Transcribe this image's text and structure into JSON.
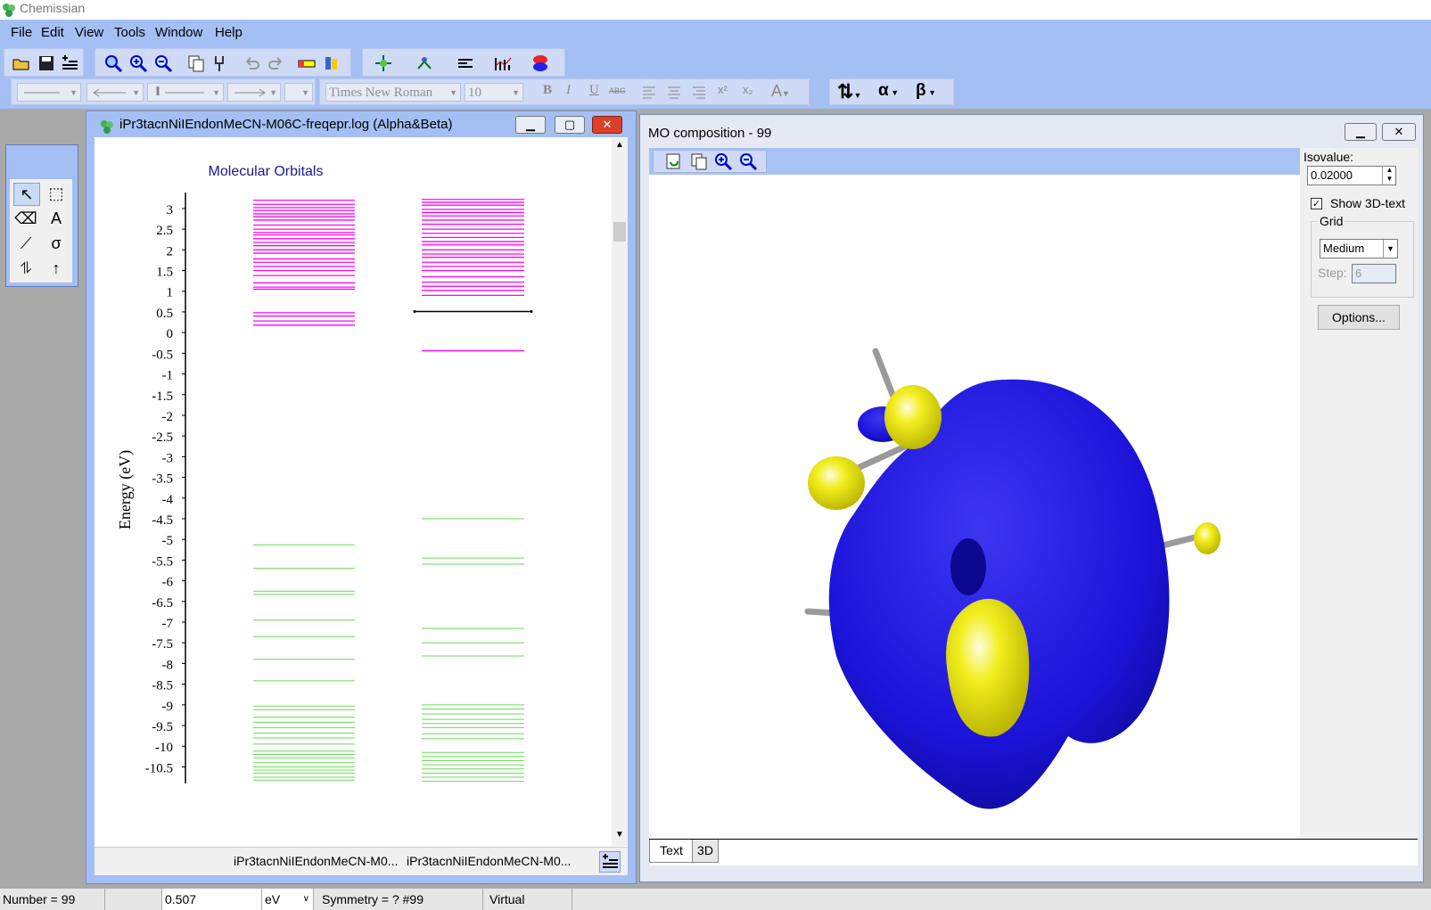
{
  "app": {
    "title": "Chemissian"
  },
  "menu": {
    "file": "File",
    "edit": "Edit",
    "view": "View",
    "tools": "Tools",
    "window": "Window",
    "help": "Help"
  },
  "format_bar": {
    "font": "Times New Roman",
    "font_size": "10",
    "bold": "B",
    "italic": "I",
    "underline": "U",
    "strike": "ABC",
    "super": "x²",
    "sub": "x₂",
    "alpha": "α",
    "beta": "β"
  },
  "palette": {
    "select": "↖",
    "area": "⬚",
    "erase": "⌫",
    "text": "A",
    "line": "⟋",
    "sigma": "σ",
    "updown": "⥮",
    "up": "↑"
  },
  "left_window": {
    "title": "iPr3tacnNiIEndonMeCN-M06C-freqepr.log (Alpha&Beta)",
    "footer_labels": [
      "iPr3tacnNiIEndonMeCN-M0...",
      "iPr3tacnNiIEndonMeCN-M0..."
    ]
  },
  "chart_data": {
    "type": "energy-level-diagram",
    "title": "Molecular Orbitals",
    "ylabel": "Energy (eV)",
    "ylim": [
      -10.9,
      3.3
    ],
    "yticks": [
      3,
      2.5,
      2,
      1.5,
      1,
      0.5,
      0,
      -0.5,
      -1,
      -1.5,
      -2,
      -2.5,
      -3,
      -3.5,
      -4,
      -4.5,
      -5,
      -5.5,
      -6,
      -6.5,
      -7,
      -7.5,
      -8,
      -8.5,
      -9,
      -9.5,
      -10,
      -10.5
    ],
    "virtual_color": "#ff00ff",
    "occupied_color": "#66dd55",
    "selected_color": "#000000",
    "series": [
      {
        "virtual": [
          3.2,
          3.1,
          3.02,
          2.95,
          2.87,
          2.8,
          2.72,
          2.6,
          2.5,
          2.42,
          2.36,
          2.27,
          2.18,
          2.1,
          2.0,
          1.92,
          1.78,
          1.7,
          1.6,
          1.5,
          1.38,
          1.2,
          1.1,
          1.05,
          0.48,
          0.4,
          0.28,
          0.18
        ],
        "occupied": [
          -5.13,
          -5.7,
          -6.25,
          -6.33,
          -6.95,
          -7.35,
          -7.9,
          -8.42,
          -9.03,
          -9.12,
          -9.3,
          -9.42,
          -9.55,
          -9.68,
          -9.8,
          -9.95,
          -10.12,
          -10.2,
          -10.28,
          -10.4,
          -10.5,
          -10.58,
          -10.65,
          -10.75,
          -10.82
        ]
      },
      {
        "virtual": [
          3.22,
          3.15,
          3.08,
          2.98,
          2.9,
          2.82,
          2.72,
          2.62,
          2.5,
          2.4,
          2.3,
          2.2,
          2.12,
          2.0,
          1.9,
          1.82,
          1.7,
          1.6,
          1.5,
          1.35,
          1.22,
          1.12,
          1.02,
          0.9,
          -0.44
        ],
        "selected": [
          0.51
        ],
        "occupied": [
          -4.5,
          -5.45,
          -5.6,
          -7.15,
          -7.5,
          -7.82,
          -9.0,
          -9.1,
          -9.22,
          -9.35,
          -9.45,
          -9.55,
          -9.7,
          -9.82,
          -10.15,
          -10.25,
          -10.35,
          -10.45,
          -10.55,
          -10.65,
          -10.75,
          -10.85
        ]
      }
    ]
  },
  "right_window": {
    "title": "MO composition - 99",
    "tabs": [
      "Text",
      "3D"
    ],
    "isovalue_label": "Isovalue:",
    "isovalue": "0.02000",
    "show_3d_text": "Show 3D-text",
    "grid_label": "Grid",
    "grid_value": "Medium",
    "step_label": "Step:",
    "step_value": "6",
    "options_button": "Options...",
    "lobe_colors": {
      "negative": "#1b13d8",
      "positive": "#f2ee1e"
    }
  },
  "status": {
    "number": "Number = 99",
    "energy": "0.507",
    "unit": "eV",
    "symmetry": "Symmetry = ? #99",
    "type": "Virtual"
  }
}
